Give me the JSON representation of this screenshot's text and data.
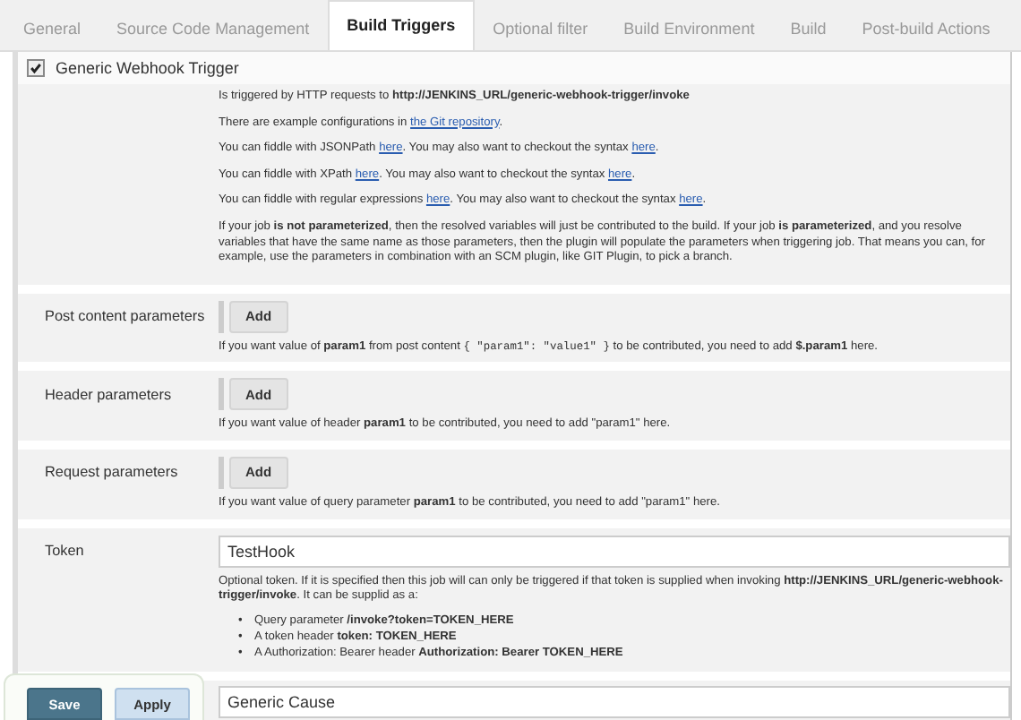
{
  "tabs": [
    {
      "label": "General",
      "selected": false
    },
    {
      "label": "Source Code Management",
      "selected": false
    },
    {
      "label": "Build Triggers",
      "selected": true
    },
    {
      "label": "Optional filter",
      "selected": false
    },
    {
      "label": "Build Environment",
      "selected": false
    },
    {
      "label": "Build",
      "selected": false
    },
    {
      "label": "Post-build Actions",
      "selected": false
    }
  ],
  "trigger": {
    "label": "Generic Webhook Trigger",
    "checked": true
  },
  "description": [
    [
      {
        "kind": "text",
        "text": "Is triggered by HTTP requests to **http://JENKINS_URL/generic-webhook-trigger/invoke**"
      }
    ],
    [
      {
        "kind": "text",
        "text": "There are example configurations in "
      },
      {
        "kind": "link",
        "text": "the Git repository"
      },
      {
        "kind": "text",
        "text": "."
      }
    ],
    [
      {
        "kind": "text",
        "text": "You can fiddle with JSONPath "
      },
      {
        "kind": "link",
        "text": "here"
      },
      {
        "kind": "text",
        "text": ". You may also want to checkout the syntax "
      },
      {
        "kind": "link",
        "text": "here"
      },
      {
        "kind": "text",
        "text": "."
      }
    ],
    [
      {
        "kind": "text",
        "text": "You can fiddle with XPath "
      },
      {
        "kind": "link",
        "text": "here"
      },
      {
        "kind": "text",
        "text": ". You may also want to checkout the syntax "
      },
      {
        "kind": "link",
        "text": "here"
      },
      {
        "kind": "text",
        "text": "."
      }
    ],
    [
      {
        "kind": "text",
        "text": "You can fiddle with regular expressions "
      },
      {
        "kind": "link",
        "text": "here"
      },
      {
        "kind": "text",
        "text": ". You may also want to checkout the syntax "
      },
      {
        "kind": "link",
        "text": "here"
      },
      {
        "kind": "text",
        "text": "."
      }
    ],
    [
      {
        "kind": "text",
        "text": "If your job **is not parameterized**, then the resolved variables will just be contributed to the build. If your job **is parameterized**, and you resolve variables that have the same name as those parameters, then the plugin will populate the parameters when triggering job. That means you can, for example, use the parameters in combination with an SCM plugin, like GIT Plugin, to pick a branch."
      }
    ]
  ],
  "parameters": [
    {
      "label": "Post content parameters",
      "button": "Add",
      "help": [
        {
          "kind": "text",
          "text": "If you want value of **param1** from post content "
        },
        {
          "kind": "code",
          "text": "{ \"param1\": \"value1\" }"
        },
        {
          "kind": "text",
          "text": " to be contributed, you need to add **$.param1** here."
        }
      ]
    },
    {
      "label": "Header parameters",
      "button": "Add",
      "help": [
        {
          "kind": "text",
          "text": "If you want value of header **param1** to be contributed, you need to add \"param1\" here."
        }
      ]
    },
    {
      "label": "Request parameters",
      "button": "Add",
      "help": [
        {
          "kind": "text",
          "text": "If you want value of query parameter **param1** to be contributed, you need to add \"param1\" here."
        }
      ]
    }
  ],
  "token": {
    "label": "Token",
    "value": "TestHook",
    "help": "Optional token. If it is specified then this job will can only be triggered if that token is supplied when invoking **http://JENKINS_URL/generic-webhook-trigger/invoke**. It can be supplid as a:",
    "bullets": [
      {
        "marker": "•",
        "text": "Query parameter **/invoke?token=TOKEN_HERE**"
      },
      {
        "marker": "•",
        "text": "A token header **token: TOKEN_HERE**"
      },
      {
        "marker": "•",
        "text": "A Authorization: Bearer header **Authorization: Bearer TOKEN_HERE**"
      }
    ]
  },
  "cause": {
    "value": "Generic Cause"
  },
  "footer": {
    "save": "Save",
    "apply": "Apply"
  }
}
